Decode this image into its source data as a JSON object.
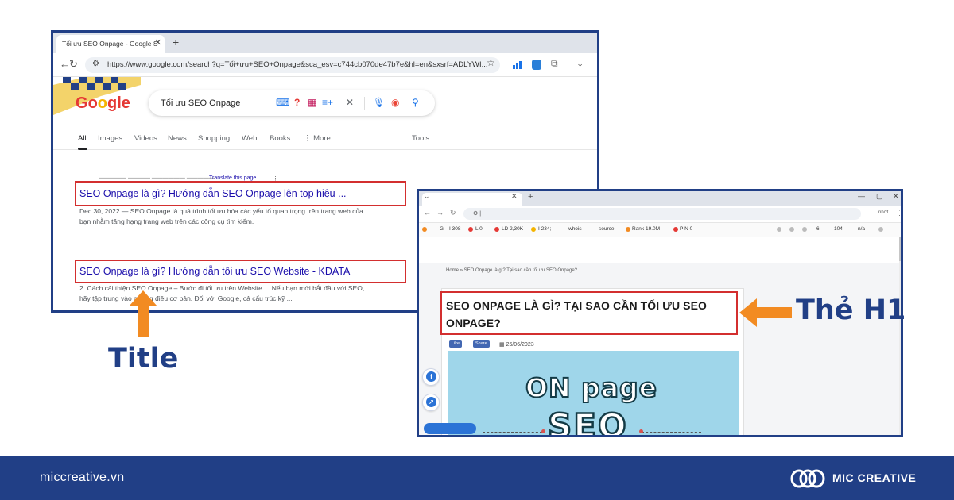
{
  "google_window": {
    "tab_title": "Tối ưu SEO Onpage - Google S",
    "url": "https://www.google.com/search?q=Tối+ưu+SEO+Onpage&sca_esv=c744cb070de47b7e&hl=en&sxsrf=ADLYWI...",
    "logo": "Google",
    "search_query": "Tối ưu SEO Onpage",
    "nav_tabs": [
      "All",
      "Images",
      "Videos",
      "News",
      "Shopping",
      "Web",
      "Books",
      "⋮ More",
      "Tools"
    ],
    "translate_link": "Translate this page",
    "result1": {
      "title": "SEO Onpage là gì? Hướng dẫn SEO Onpage lên top hiệu ...",
      "snippet_line1": "Dec 30, 2022 — SEO Onpage là quá trình tối ưu hóa các yếu tố quan trọng trên trang web của",
      "snippet_line2": "bạn nhằm tăng hạng trang web trên các công cụ tìm kiếm."
    },
    "result2": {
      "title": "SEO Onpage là gì? Hướng dẫn tối ưu SEO Website - KDATA",
      "snippet_line1": "2. Cách cải thiện SEO Onpage – Bước đi tối ưu trên Website ... Nếu bạn mới bắt đầu với SEO,",
      "snippet_line2": "hãy tập trung vào những điều cơ bản. Đối với Google, cả cấu trúc kỹ ..."
    }
  },
  "site_window": {
    "url_right": "nhớt",
    "seo_toolbar": [
      "G",
      "I 308",
      "L 0",
      "LD 2,30K",
      "I 234;",
      "whois",
      "source",
      "Rank 19.0M",
      "PIN 0",
      "6",
      "104",
      "n/a"
    ],
    "breadcrumb": "Home » SEO Onpage là gì? Tại sao cần tối ưu SEO Onpage?",
    "h1": "SEO ONPAGE LÀ GÌ? TẠI SAO CẦN TỐI ƯU SEO ONPAGE?",
    "like_label": "Like",
    "share_label": "Share",
    "date": "26/06/2023",
    "hero_line1": "ON page",
    "hero_line2": "SEO"
  },
  "annotations": {
    "title_label": "Title",
    "h1_label": "Thẻ H1",
    "arrow_color": "#f28b22",
    "label_color": "#213f86",
    "box_color": "#d32f2f"
  },
  "footer": {
    "website": "miccreative.vn",
    "brand": "MIC CREATIVE",
    "background": "#213f86"
  }
}
